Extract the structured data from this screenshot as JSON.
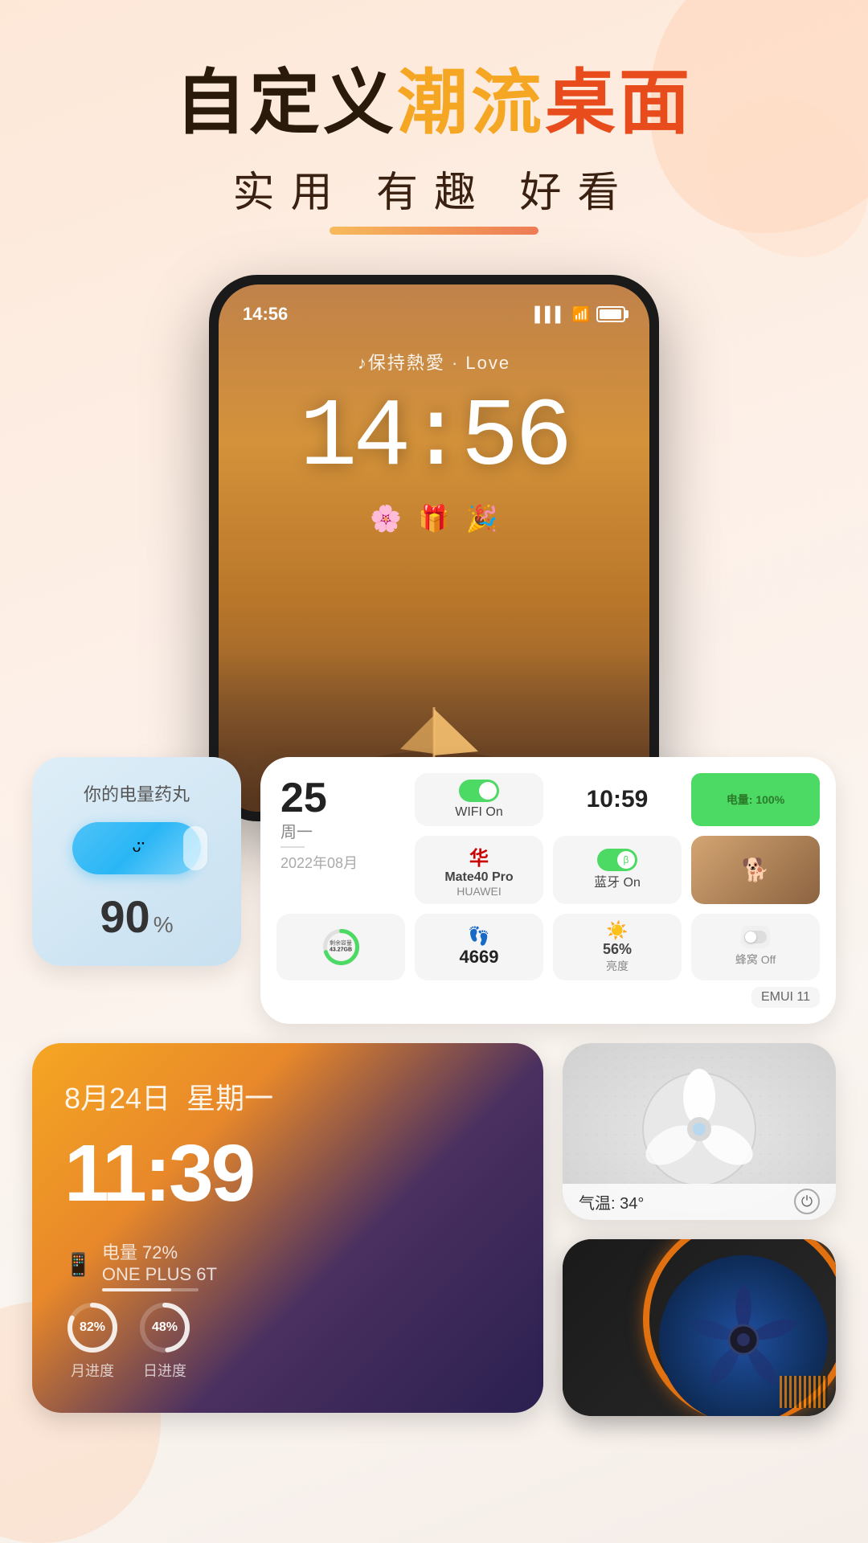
{
  "header": {
    "title_part1": "自定义",
    "title_part2": "潮流",
    "title_part3": "桌面",
    "subtitle": "实用  有趣  好看"
  },
  "phone": {
    "status_time": "14:56",
    "music_text": "♪保持熱愛 · Love",
    "clock_display": "14:56",
    "lock_icons": "🌸 🎁 🎉"
  },
  "widget_battery_pill": {
    "label": "你的电量药丸",
    "percent": "90",
    "unit": "%"
  },
  "widget_info": {
    "date_day": "25",
    "date_week": "周一",
    "date_separator": "—",
    "date_month": "2022年08月",
    "wifi_label": "WIFI On",
    "time": "10:59",
    "battery_label": "电量: 100%",
    "device_name": "Mate40 Pro",
    "device_brand": "HUAWEI",
    "bt_label": "蓝牙 On",
    "storage_label": "剩余容量",
    "storage_value": "43.27GB",
    "steps_icon": "👟",
    "steps_value": "4669",
    "brightness_icon": "☀",
    "brightness_label": "亮度",
    "brightness_value": "56%",
    "hive_label": "蜂窝 Off",
    "emui_label": "EMUI 11"
  },
  "widget_datetime": {
    "date": "8月24日",
    "weekday": "星期一",
    "time": "11:39",
    "device_icon": "📱",
    "device_label": "电量 72%",
    "device_name": "ONE PLUS 6T",
    "progress1_value": "82%",
    "progress1_label": "月进度",
    "progress1_percent": 82,
    "progress2_value": "48%",
    "progress2_label": "日进度",
    "progress2_percent": 48
  },
  "widget_fan_white": {
    "temp_label": "气温: 34°",
    "power_icon": "⏻"
  },
  "widget_fan_dark": {
    "type": "industrial_fan"
  },
  "icons": {
    "wifi": "📶",
    "bluetooth": "🔵",
    "signal_bars": "▌▌▌▌",
    "battery_full": "🔋"
  }
}
